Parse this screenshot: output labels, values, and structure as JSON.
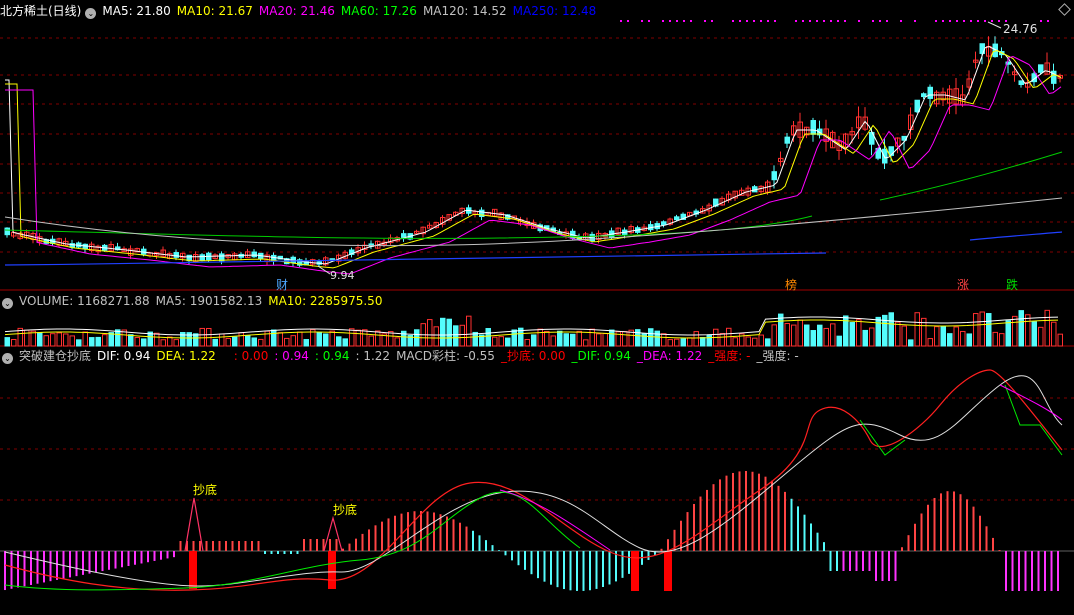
{
  "header_price": {
    "title": "北方稀土(日线)",
    "items": [
      {
        "text": "MA5: 21.80",
        "color": "#ffffff"
      },
      {
        "text": "MA10: 21.67",
        "color": "#ffff00"
      },
      {
        "text": "MA20: 21.46",
        "color": "#ff00ff"
      },
      {
        "text": "MA60: 17.26",
        "color": "#00ff00"
      },
      {
        "text": "MA120: 14.52",
        "color": "#c0c0c0"
      },
      {
        "text": "MA250: 12.48",
        "color": "#0000ff"
      }
    ]
  },
  "price_labels": {
    "high": "24.76",
    "low": "9.94"
  },
  "markers": [
    {
      "text": "财",
      "color": "#4da6ff"
    },
    {
      "text": "榜",
      "color": "#ff8800"
    },
    {
      "text": "涨",
      "color": "#ff4444"
    },
    {
      "text": "跌",
      "color": "#00dd00"
    }
  ],
  "header_volume": {
    "items": [
      {
        "text": "VOLUME: 1168271.88",
        "color": "#c0c0c0"
      },
      {
        "text": "MA5: 1901582.13",
        "color": "#c0c0c0"
      },
      {
        "text": "MA10: 2285975.50",
        "color": "#ffff00"
      }
    ]
  },
  "header_macd": {
    "items": [
      {
        "text": "突破建仓抄底",
        "color": "#c0c0c0"
      },
      {
        "text": "DIF: 0.94",
        "color": "#ffffff"
      },
      {
        "text": "DEA: 1.22",
        "color": "#ffff00"
      },
      {
        "text": ": 0.00",
        "color": "#ff0000"
      },
      {
        "text": ": 0.94",
        "color": "#ff00ff"
      },
      {
        "text": ": 0.94",
        "color": "#00ff00"
      },
      {
        "text": ": 1.22",
        "color": "#c0c0c0"
      },
      {
        "text": "MACD彩柱: -0.55",
        "color": "#c0c0c0"
      },
      {
        "text": "_抄底: 0.00",
        "color": "#ff0000"
      },
      {
        "text": "_DIF: 0.94",
        "color": "#00ff00"
      },
      {
        "text": "_DEA: 1.22",
        "color": "#ff00ff"
      },
      {
        "text": "_强度: -",
        "color": "#ff0000"
      },
      {
        "text": "_强度: -",
        "color": "#c0c0c0"
      }
    ]
  },
  "signals": [
    {
      "text": "抄底",
      "color": "#ffff00"
    },
    {
      "text": "抄底",
      "color": "#ffff00"
    }
  ],
  "colors": {
    "up": "#ff3030",
    "down": "#54fcfc",
    "grid": "#800000",
    "divider": "#a00000"
  }
}
